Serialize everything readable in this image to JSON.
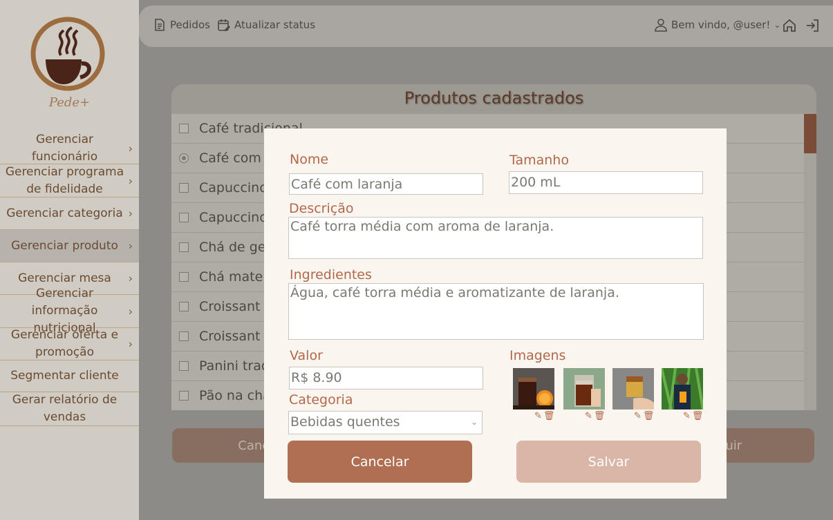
{
  "brand": {
    "name": "Pede+"
  },
  "sidebar": {
    "items": [
      {
        "label": "Gerenciar funcionário"
      },
      {
        "label": "Gerenciar programa de fidelidade"
      },
      {
        "label": "Gerenciar categoria"
      },
      {
        "label": "Gerenciar produto"
      },
      {
        "label": "Gerenciar mesa"
      },
      {
        "label": "Gerenciar informação nutricional"
      },
      {
        "label": "Gerenciar oferta e promoção"
      },
      {
        "label": "Segmentar cliente"
      },
      {
        "label": "Gerar relatório de vendas"
      }
    ]
  },
  "topbar": {
    "orders_label": "Pedidos",
    "update_status_label": "Atualizar status",
    "welcome_label": "Bem vindo, @user!"
  },
  "products": {
    "title": "Produtos cadastrados",
    "rows": [
      {
        "name": "Café tradicional"
      },
      {
        "name": "Café com laranja"
      },
      {
        "name": "Capuccino"
      },
      {
        "name": "Capuccino"
      },
      {
        "name": "Chá de gengibre"
      },
      {
        "name": "Chá mate"
      },
      {
        "name": "Croissant"
      },
      {
        "name": "Croissant"
      },
      {
        "name": "Panini tradicional"
      },
      {
        "name": "Pão na chapa"
      }
    ],
    "cancel_label": "Cancelar",
    "delete_label": "Excluir"
  },
  "modal": {
    "name_label": "Nome",
    "name_value": "Café com laranja",
    "size_label": "Tamanho",
    "size_value": "200 mL",
    "description_label": "Descrição",
    "description_value": "Café torra média com aroma de laranja.",
    "ingredients_label": "Ingredientes",
    "ingredients_value": "Água, café torra média e aromatizante de laranja.",
    "price_label": "Valor",
    "price_value": "R$ 8.90",
    "category_label": "Categoria",
    "category_value": "Bebidas quentes",
    "images_label": "Imagens",
    "cancel_label": "Cancelar",
    "save_label": "Salvar"
  },
  "colors": {
    "accent": "#b06e52",
    "accent_light": "#d9b6a6",
    "label": "#b2674a",
    "modal_bg": "#faf6ef"
  }
}
